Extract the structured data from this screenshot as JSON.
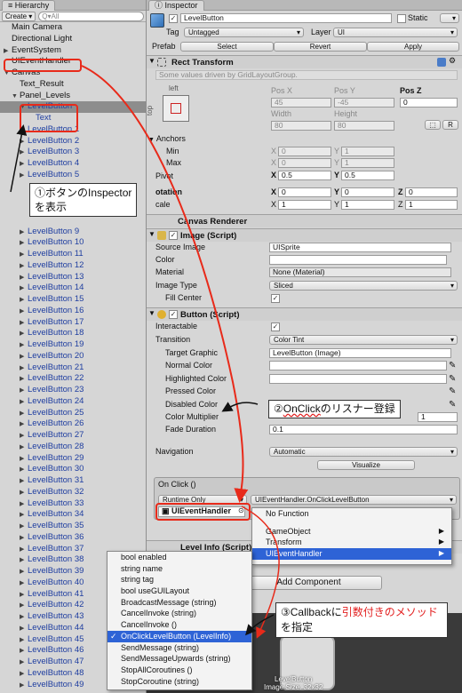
{
  "hierarchy": {
    "tab": "Hierarchy",
    "create": "Create ▾",
    "search_placeholder": "Q▾All",
    "items": [
      {
        "label": "Main Camera",
        "indent": 0,
        "tri": "",
        "blue": false
      },
      {
        "label": "Directional Light",
        "indent": 0,
        "tri": "",
        "blue": false
      },
      {
        "label": "EventSystem",
        "indent": 0,
        "tri": "▶",
        "blue": false
      },
      {
        "label": "UIEventHandler",
        "indent": 0,
        "tri": "",
        "blue": false
      },
      {
        "label": "Canvas",
        "indent": 0,
        "tri": "▼",
        "blue": false
      },
      {
        "label": "Text_Result",
        "indent": 1,
        "tri": "",
        "blue": false
      },
      {
        "label": "Panel_Levels",
        "indent": 1,
        "tri": "▼",
        "blue": false
      },
      {
        "label": "LevelButton",
        "indent": 2,
        "tri": "▼",
        "blue": true,
        "sel": true
      },
      {
        "label": "Text",
        "indent": 3,
        "tri": "",
        "blue": true
      },
      {
        "label": "LevelButton 1",
        "indent": 2,
        "tri": "▶",
        "blue": true
      },
      {
        "label": "LevelButton 2",
        "indent": 2,
        "tri": "▶",
        "blue": true
      },
      {
        "label": "LevelButton 3",
        "indent": 2,
        "tri": "▶",
        "blue": true
      },
      {
        "label": "LevelButton 4",
        "indent": 2,
        "tri": "▶",
        "blue": true
      },
      {
        "label": "LevelButton 5",
        "indent": 2,
        "tri": "▶",
        "blue": true
      },
      {
        "label": "",
        "indent": 2,
        "tri": "",
        "blue": true
      },
      {
        "label": "",
        "indent": 2,
        "tri": "",
        "blue": true
      },
      {
        "label": "",
        "indent": 2,
        "tri": "",
        "blue": true
      },
      {
        "label": "",
        "indent": 2,
        "tri": "",
        "blue": true
      },
      {
        "label": "LevelButton 9",
        "indent": 2,
        "tri": "▶",
        "blue": true
      },
      {
        "label": "LevelButton 10",
        "indent": 2,
        "tri": "▶",
        "blue": true
      },
      {
        "label": "LevelButton 11",
        "indent": 2,
        "tri": "▶",
        "blue": true
      },
      {
        "label": "LevelButton 12",
        "indent": 2,
        "tri": "▶",
        "blue": true
      },
      {
        "label": "LevelButton 13",
        "indent": 2,
        "tri": "▶",
        "blue": true
      },
      {
        "label": "LevelButton 14",
        "indent": 2,
        "tri": "▶",
        "blue": true
      },
      {
        "label": "LevelButton 15",
        "indent": 2,
        "tri": "▶",
        "blue": true
      },
      {
        "label": "LevelButton 16",
        "indent": 2,
        "tri": "▶",
        "blue": true
      },
      {
        "label": "LevelButton 17",
        "indent": 2,
        "tri": "▶",
        "blue": true
      },
      {
        "label": "LevelButton 18",
        "indent": 2,
        "tri": "▶",
        "blue": true
      },
      {
        "label": "LevelButton 19",
        "indent": 2,
        "tri": "▶",
        "blue": true
      },
      {
        "label": "LevelButton 20",
        "indent": 2,
        "tri": "▶",
        "blue": true
      },
      {
        "label": "LevelButton 21",
        "indent": 2,
        "tri": "▶",
        "blue": true
      },
      {
        "label": "LevelButton 22",
        "indent": 2,
        "tri": "▶",
        "blue": true
      },
      {
        "label": "LevelButton 23",
        "indent": 2,
        "tri": "▶",
        "blue": true
      },
      {
        "label": "LevelButton 24",
        "indent": 2,
        "tri": "▶",
        "blue": true
      },
      {
        "label": "LevelButton 25",
        "indent": 2,
        "tri": "▶",
        "blue": true
      },
      {
        "label": "LevelButton 26",
        "indent": 2,
        "tri": "▶",
        "blue": true
      },
      {
        "label": "LevelButton 27",
        "indent": 2,
        "tri": "▶",
        "blue": true
      },
      {
        "label": "LevelButton 28",
        "indent": 2,
        "tri": "▶",
        "blue": true
      },
      {
        "label": "LevelButton 29",
        "indent": 2,
        "tri": "▶",
        "blue": true
      },
      {
        "label": "LevelButton 30",
        "indent": 2,
        "tri": "▶",
        "blue": true
      },
      {
        "label": "LevelButton 31",
        "indent": 2,
        "tri": "▶",
        "blue": true
      },
      {
        "label": "LevelButton 32",
        "indent": 2,
        "tri": "▶",
        "blue": true
      },
      {
        "label": "LevelButton 33",
        "indent": 2,
        "tri": "▶",
        "blue": true
      },
      {
        "label": "LevelButton 34",
        "indent": 2,
        "tri": "▶",
        "blue": true
      },
      {
        "label": "LevelButton 35",
        "indent": 2,
        "tri": "▶",
        "blue": true
      },
      {
        "label": "LevelButton 36",
        "indent": 2,
        "tri": "▶",
        "blue": true
      },
      {
        "label": "LevelButton 37",
        "indent": 2,
        "tri": "▶",
        "blue": true
      },
      {
        "label": "LevelButton 38",
        "indent": 2,
        "tri": "▶",
        "blue": true
      },
      {
        "label": "LevelButton 39",
        "indent": 2,
        "tri": "▶",
        "blue": true
      },
      {
        "label": "LevelButton 40",
        "indent": 2,
        "tri": "▶",
        "blue": true
      },
      {
        "label": "LevelButton 41",
        "indent": 2,
        "tri": "▶",
        "blue": true
      },
      {
        "label": "LevelButton 42",
        "indent": 2,
        "tri": "▶",
        "blue": true
      },
      {
        "label": "LevelButton 43",
        "indent": 2,
        "tri": "▶",
        "blue": true
      },
      {
        "label": "LevelButton 44",
        "indent": 2,
        "tri": "▶",
        "blue": true
      },
      {
        "label": "LevelButton 45",
        "indent": 2,
        "tri": "▶",
        "blue": true
      },
      {
        "label": "LevelButton 46",
        "indent": 2,
        "tri": "▶",
        "blue": true
      },
      {
        "label": "LevelButton 47",
        "indent": 2,
        "tri": "▶",
        "blue": true
      },
      {
        "label": "LevelButton 48",
        "indent": 2,
        "tri": "▶",
        "blue": true
      },
      {
        "label": "LevelButton 49",
        "indent": 2,
        "tri": "▶",
        "blue": true
      }
    ]
  },
  "inspector": {
    "tab": "Inspector",
    "name": "LevelButton",
    "static_label": "Static",
    "tag_label": "Tag",
    "tag_value": "Untagged",
    "layer_label": "Layer",
    "layer_value": "UI",
    "prefab_label": "Prefab",
    "select": "Select",
    "revert": "Revert",
    "apply": "Apply",
    "rect_title": "Rect Transform",
    "rect_note": "Some values driven by GridLayoutGroup.",
    "left_label": "left",
    "top_label": "top",
    "posx_label": "Pos X",
    "posy_label": "Pos Y",
    "posz_label": "Pos Z",
    "posx": "45",
    "posy": "-45",
    "posz": "0",
    "width_label": "Width",
    "height_label": "Height",
    "width": "80",
    "height": "80",
    "r_btn": "R",
    "anchors": "Anchors",
    "min": "Min",
    "max": "Max",
    "pivot": "Pivot",
    "x": "X",
    "y": "Y",
    "z": "Z",
    "min_x": "0",
    "min_y": "1",
    "max_x": "0",
    "max_y": "1",
    "pivot_x": "0.5",
    "pivot_y": "0.5",
    "rotation": "otation",
    "rot_x": "0",
    "rot_y": "0",
    "rot_z": "0",
    "scale": "cale",
    "scale_x": "1",
    "scale_y": "1",
    "scale_z": "1",
    "canvas_renderer": "Canvas Renderer",
    "image_title": "Image (Script)",
    "source_image": "Source Image",
    "source_image_val": "UISprite",
    "color": "Color",
    "material": "Material",
    "material_val": "None (Material)",
    "image_type": "Image Type",
    "image_type_val": "Sliced",
    "fill_center": "Fill Center",
    "button_title": "Button (Script)",
    "interactable": "Interactable",
    "transition": "Transition",
    "transition_val": "Color Tint",
    "target_graphic": "Target Graphic",
    "target_graphic_val": "LevelButton (Image)",
    "normal_color": "Normal Color",
    "highlighted_color": "Highlighted Color",
    "pressed_color": "Pressed Color",
    "disabled_color": "Disabled Color",
    "color_multiplier": "Color Multiplier",
    "color_multiplier_val": "1",
    "fade_duration": "Fade Duration",
    "fade_duration_val": "0.1",
    "navigation": "Navigation",
    "navigation_val": "Automatic",
    "visualize": "Visualize",
    "onclick": "On Click ()",
    "runtime_only": "Runtime Only",
    "function_val": "UIEventHandler.OnClickLevelButton",
    "object_val": "UIEventHandler",
    "level_info": "Level Info (Script)",
    "add_component": "Add Component",
    "preview_label": "LevelButton\nImage Size: 32x32"
  },
  "menu1": {
    "items": [
      "No Function",
      "",
      "GameObject",
      "Transform",
      "UIEventHandler"
    ]
  },
  "menu2": {
    "items": [
      "bool enabled",
      "string name",
      "string tag",
      "bool useGUILayout",
      "BroadcastMessage (string)",
      "CancelInvoke (string)",
      "CancelInvoke ()",
      "OnClickLevelButton (LevelInfo)",
      "SendMessage (string)",
      "SendMessageUpwards (string)",
      "StopAllCoroutines ()",
      "StopCoroutine (string)"
    ]
  },
  "annotations": {
    "a1_line1": "①ボタンのInspector",
    "a1_line2": "を表示",
    "a2_a": "②",
    "a2_b": "OnClick",
    "a2_c": "のリスナー登録",
    "a3_a": "③Callbackに",
    "a3_b": "引数付きのメ",
    "a3_c": "ソッド",
    "a3_d": "を指定"
  },
  "colors": {
    "accent": "#e82a1a",
    "highlight": "#2e63d6",
    "link": "#1f3ea0"
  }
}
